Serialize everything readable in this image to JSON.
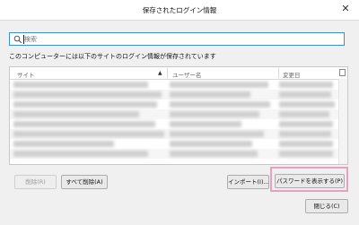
{
  "window": {
    "title": "保存されたログイン情報",
    "close_glyph": "✕"
  },
  "search": {
    "value": "",
    "placeholder": "検索"
  },
  "description": "このコンピューターには以下のサイトのログイン情報が保存されています",
  "table": {
    "columns": [
      "サイト",
      "ユーザー名",
      "変更日"
    ]
  },
  "buttons": {
    "delete": "削除(R)",
    "delete_all": "すべて削除(A)",
    "import": "インポート(I)...",
    "show_passwords": "パスワードを表示する(P)",
    "close": "閉じる(C)"
  },
  "colors": {
    "accent": "#3b8ed8",
    "highlight": "#e8a0c0"
  }
}
